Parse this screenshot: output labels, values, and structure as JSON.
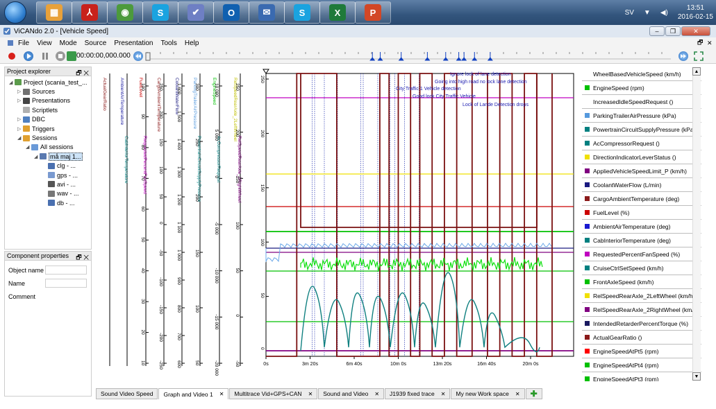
{
  "taskbar": {
    "apps": [
      {
        "icon": "metro-apps-icon",
        "color": "#e8a13a",
        "glyph": "▦"
      },
      {
        "icon": "pdf-icon",
        "color": "#c8221b",
        "glyph": "⅄"
      },
      {
        "icon": "chrome-icon",
        "color": "#4c9a3c",
        "glyph": "◉"
      },
      {
        "icon": "skype-icon",
        "color": "#1aa3e0",
        "glyph": "S"
      },
      {
        "icon": "vicando-icon",
        "color": "#6e7fc4",
        "glyph": "✔"
      },
      {
        "icon": "outlook-icon",
        "color": "#1060b0",
        "glyph": "O"
      },
      {
        "icon": "thunderbird-icon",
        "color": "#3a6ab0",
        "glyph": "✉"
      },
      {
        "icon": "skype-icon",
        "color": "#1aa3e0",
        "glyph": "S"
      },
      {
        "icon": "excel-icon",
        "color": "#1f7a3a",
        "glyph": "X"
      },
      {
        "icon": "powerpoint-icon",
        "color": "#d24726",
        "glyph": "P"
      }
    ],
    "language": "SV",
    "time": "13:51",
    "date": "2016-02-15"
  },
  "window": {
    "title": "ViCANdo 2.0 - [Vehicle Speed]"
  },
  "menu": [
    "File",
    "View",
    "Mode",
    "Source",
    "Presentation",
    "Tools",
    "Help"
  ],
  "toolbar": {
    "time": "00:00:00,000.000"
  },
  "timeline": {
    "markers": [
      0.43,
      0.445,
      0.485,
      0.535,
      0.57,
      0.595,
      0.605,
      0.625,
      0.655
    ]
  },
  "explorer": {
    "title": "Project explorer",
    "items": [
      {
        "label": "Project (scania_test_...",
        "level": 0,
        "tw": "◢",
        "icon": "project-icon",
        "color": "#5b9b4b"
      },
      {
        "label": "Sources",
        "level": 1,
        "tw": "▷",
        "icon": "sources-icon",
        "color": "#707070"
      },
      {
        "label": "Presentations",
        "level": 1,
        "tw": "▷",
        "icon": "presentations-icon",
        "color": "#444"
      },
      {
        "label": "Scriptlets",
        "level": 1,
        "tw": "",
        "icon": "scriptlets-icon",
        "color": "#b0b0b0"
      },
      {
        "label": "DBC",
        "level": 1,
        "tw": "▷",
        "icon": "dbc-icon",
        "color": "#5080c0"
      },
      {
        "label": "Triggers",
        "level": 1,
        "tw": "▷",
        "icon": "triggers-icon",
        "color": "#e0a030"
      },
      {
        "label": "Sessions",
        "level": 1,
        "tw": "◢",
        "icon": "sessions-icon",
        "color": "#e0a030"
      },
      {
        "label": "All sessions",
        "level": 2,
        "tw": "◢",
        "icon": "all-sessions-icon",
        "color": "#6a9ad8"
      },
      {
        "label": "må maj 1...",
        "level": 3,
        "tw": "◢",
        "icon": "session-icon",
        "color": "#5a7ab0",
        "selected": true
      },
      {
        "label": "clg - ...",
        "level": 4,
        "tw": "",
        "icon": "can-log-icon",
        "color": "#4a70b0"
      },
      {
        "label": "gps - ...",
        "level": 4,
        "tw": "",
        "icon": "gps-icon",
        "color": "#7a9ad0"
      },
      {
        "label": "avi - ...",
        "level": 4,
        "tw": "",
        "icon": "video-icon",
        "color": "#555"
      },
      {
        "label": "wav - ...",
        "level": 4,
        "tw": "",
        "icon": "audio-icon",
        "color": "#777"
      },
      {
        "label": "db - ...",
        "level": 4,
        "tw": "",
        "icon": "database-icon",
        "color": "#4a70b0"
      }
    ]
  },
  "properties": {
    "title": "Component properties",
    "fields": [
      "Object name",
      "Name",
      "Comment"
    ]
  },
  "axes": [
    {
      "label": "ActualGearRatio",
      "label2": "",
      "color": "#8b1a1a",
      "ticks": []
    },
    {
      "label": "AmbientAirTemperature",
      "label2": "CabInteriorTemperature",
      "color": "#1a1aa0",
      "color2": "#008080",
      "ticks": []
    },
    {
      "label": "FuelLevel",
      "label2": "RequestedPercentFanSpeed",
      "color": "#cc0000",
      "color2": "#c000c0",
      "ticks": [
        "100",
        "90",
        "80",
        "70",
        "60",
        "50",
        "40",
        "30",
        "20",
        "10"
      ]
    },
    {
      "label": "CargoAmbientTemperature",
      "label2": "",
      "color": "#8b1a1a",
      "ticks": [
        "250",
        "200",
        "150",
        "100",
        "50",
        "0",
        "-50",
        "-100",
        "-150",
        "-200",
        "-250"
      ]
    },
    {
      "label": "CoolantWaterFlow",
      "label2": "",
      "color": "#1a1a80",
      "ticks": [
        "1 600",
        "1 500",
        "1 400",
        "1 300",
        "1 200",
        "1 100",
        "1 000",
        "900",
        "800",
        "700",
        "600"
      ]
    },
    {
      "label": "ParkingTrailerAirPressure",
      "label2": "PowertrainCircuitSupplyPressure",
      "color": "#5599dd",
      "color2": "#008080",
      "ticks": [
        "300",
        "250",
        "200",
        "150",
        "100",
        "50"
      ]
    },
    {
      "label": "EngineSpeed",
      "label2": "AcCompressorRequest",
      "color": "#00c000",
      "color2": "#008080",
      "ticks": [
        "10 000",
        "5 000",
        "0",
        "-5 000",
        "-10 000",
        "-15 000",
        "-20 000"
      ]
    },
    {
      "label": "RelSpeedRearAxle_2LeftWheel",
      "label2": "RelSpeedRearAxle_2RightWheel",
      "color": "#c0c000",
      "color2": "#800080",
      "ticks": [
        "250",
        "200",
        "150",
        "100",
        "50",
        "0",
        "-50"
      ]
    }
  ],
  "plot": {
    "yticks": [
      "250",
      "200",
      "150",
      "100",
      "50",
      "0"
    ],
    "xticks": [
      "0s",
      "3m 20s",
      "6m 40s",
      "10m 0s",
      "13m 20s",
      "16m 40s",
      "20m 0s"
    ],
    "annotations": [
      "Ignore lock of lane detection",
      "Going into high road no lock lane detection",
      "City Traffic 1 Vehicle detection",
      "Good lock City Traffic Vehicle",
      "Lock of Lande Detection drops"
    ]
  },
  "legend": [
    {
      "label": "WheelBasedVehicleSpeed (km/h)",
      "color": "#ffffff"
    },
    {
      "label": "EngineSpeed (rpm)",
      "color": "#00c000"
    },
    {
      "label": "IncreasedIdleSpeedRequest ()",
      "color": "#ffffff"
    },
    {
      "label": "ParkingTrailerAirPressure (kPa)",
      "color": "#5599dd"
    },
    {
      "label": "PowertrainCircuitSupplyPressure (kPa)",
      "color": "#008080"
    },
    {
      "label": "AcCompressorRequest ()",
      "color": "#008080"
    },
    {
      "label": "DirectionIndicatorLeverStatus ()",
      "color": "#f0e000"
    },
    {
      "label": "AppliedVehicleSpeedLimit_P (km/h)",
      "color": "#800080"
    },
    {
      "label": "CoolantWaterFlow (L/min)",
      "color": "#1a1a80"
    },
    {
      "label": "CargoAmbientTemperature (deg)",
      "color": "#8b1a1a"
    },
    {
      "label": "FuelLevel (%)",
      "color": "#cc0000"
    },
    {
      "label": "AmbientAirTemperature (deg)",
      "color": "#1a1ad0"
    },
    {
      "label": "CabInteriorTemperature (deg)",
      "color": "#008080"
    },
    {
      "label": "RequestedPercentFanSpeed (%)",
      "color": "#c000c0"
    },
    {
      "label": "CruiseCtrlSetSpeed (km/h)",
      "color": "#008080"
    },
    {
      "label": "FrontAxleSpeed (km/h)",
      "color": "#00c000"
    },
    {
      "label": "RelSpeedRearAxle_2LeftWheel (km/h)",
      "color": "#f0e000"
    },
    {
      "label": "RelSpeedRearAxle_2RightWheel (km/h)",
      "color": "#800080"
    },
    {
      "label": "IntendedRetarderPercentTorque (%)",
      "color": "#1a1a60"
    },
    {
      "label": "ActualGearRatio ()",
      "color": "#8b1a1a"
    },
    {
      "label": "EngineSpeedAtPt5 (rpm)",
      "color": "#ff0000"
    },
    {
      "label": "EngineSpeedAtPt4 (rpm)",
      "color": "#00c000"
    },
    {
      "label": "EngineSpeedAtPt3 (rpm)",
      "color": "#00c000"
    }
  ],
  "tabs": [
    {
      "label": "Sound Video Speed",
      "close": false,
      "active": false
    },
    {
      "label": "Graph and Video 1",
      "close": true,
      "active": true
    },
    {
      "label": "Multitrace Vid+GPS+CAN",
      "close": true,
      "active": false
    },
    {
      "label": "Sound and Video",
      "close": true,
      "active": false
    },
    {
      "label": "J1939 fixed trace",
      "close": true,
      "active": false
    },
    {
      "label": "My new Work space",
      "close": true,
      "active": false
    }
  ]
}
